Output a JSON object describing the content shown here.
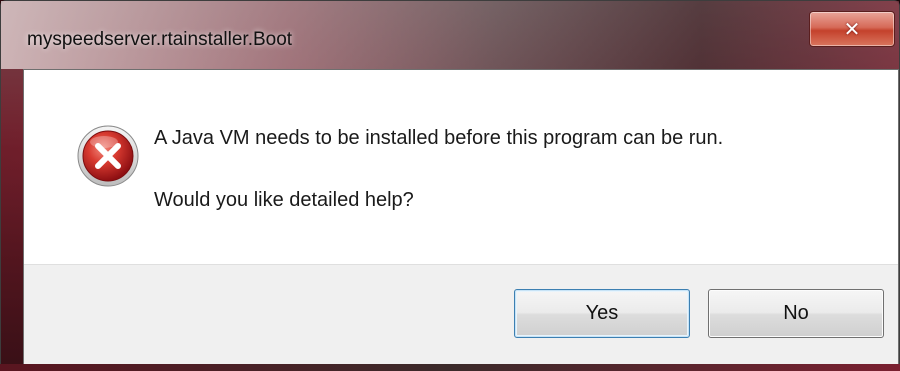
{
  "window": {
    "title": "myspeedserver.rtainstaller.Boot",
    "close_icon": "close-icon"
  },
  "message": {
    "icon": "error-icon",
    "line1": "A Java VM needs to be installed before this program can be run.",
    "line2": "Would you like detailed help?"
  },
  "buttons": {
    "yes_label": "Yes",
    "no_label": "No"
  },
  "colors": {
    "accent_focus": "#3c7fb1",
    "error_red": "#c8191d",
    "close_button_red": "#c4412c",
    "button_area_bg": "#f0f0f0"
  }
}
